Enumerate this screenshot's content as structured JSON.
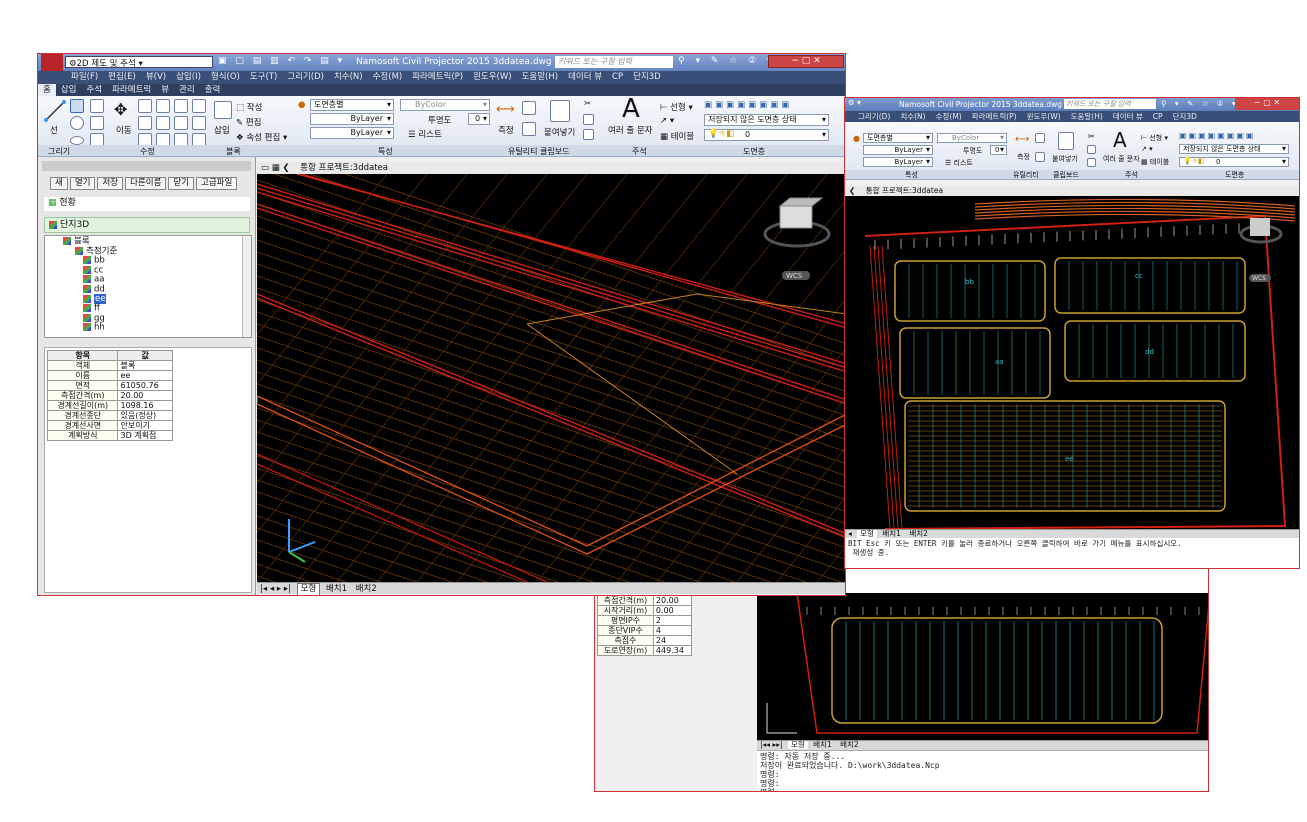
{
  "win3": {
    "props": [
      [
        "측점간격(m)",
        "20.00"
      ],
      [
        "시작거리(m)",
        "0.00"
      ],
      [
        "평면IP수",
        "2"
      ],
      [
        "종단VIP수",
        "4"
      ],
      [
        "측점수",
        "24"
      ],
      [
        "도로연장(m)",
        "449.34"
      ]
    ],
    "tabs": [
      "모형",
      "배치1",
      "배치2"
    ],
    "command_lines": "명령: 자동 저장 중...\n저장이 완료되었습니다. D:\\work\\3ddatea.Ncp\n명령:\n명령:\n명령:"
  },
  "win1": {
    "workspace": "2D 제도 및 주석",
    "title": "Namosoft Civil Projector 2015    3ddatea.dwg",
    "search_placeholder": "키워드 또는 구절 입력",
    "menu": [
      "파일(F)",
      "편집(E)",
      "뷰(V)",
      "삽입(I)",
      "형식(O)",
      "도구(T)",
      "그리기(D)",
      "치수(N)",
      "수정(M)",
      "파라메트릭(P)",
      "윈도우(W)",
      "도움말(H)",
      "데이터 뷰",
      "CP",
      "단지3D"
    ],
    "tabs": [
      "홈",
      "삽입",
      "주석",
      "파라메트릭",
      "뷰",
      "관리",
      "출력"
    ],
    "ribbon": {
      "draw_line": "선",
      "move": "이동",
      "insert": "삽입",
      "block_create": "작성",
      "block_edit": "편집",
      "attr_edit": "속성 편집",
      "layer": "도면층별",
      "bylayer1": "ByLayer",
      "bylayer2": "ByLayer",
      "bycolor": "ByColor",
      "transparency": "투명도",
      "transparency_value": "0",
      "list": "리스트",
      "measure": "측정",
      "paste": "붙여넣기",
      "multiline_text": "여러 줄 문자",
      "linear": "선형",
      "table": "테이블",
      "layer_state": "저장되지 않은 도면층 상태",
      "layer_value": "0",
      "groups": [
        "그리기",
        "수정",
        "블록",
        "특성",
        "유틸리티",
        "클립보드",
        "주석",
        "도면층"
      ]
    },
    "panel": {
      "buttons": [
        "새",
        "열기",
        "저장",
        "다른이름",
        "닫기",
        "고급파일"
      ],
      "status": "현황",
      "root": "단지3D",
      "tree": [
        "블록",
        "측점기준",
        "bb",
        "cc",
        "aa",
        "dd",
        "ee",
        "ff",
        "gg",
        "hh"
      ],
      "table_headers": [
        "항목",
        "값"
      ],
      "rows": [
        [
          "객체",
          "블록"
        ],
        [
          "이름",
          "ee"
        ],
        [
          "면적",
          "61050.76"
        ],
        [
          "측점간격(m)",
          "20.00"
        ],
        [
          "경계선길이(m)",
          "1098.16"
        ],
        [
          "경계선종단",
          "있음(정상)"
        ],
        [
          "경계선사면",
          "안보이기"
        ],
        [
          "계획방식",
          "3D 계획점"
        ]
      ]
    },
    "viewport_label": "통합 프로젝트:3ddatea",
    "tabs_bottom": [
      "모형",
      "배치1",
      "배치2"
    ],
    "wcs": "WCS"
  },
  "win2": {
    "title": "Namosoft Civil Projector 2015    3ddatea.dwg",
    "search_placeholder": "키워드 또는 구절 입력",
    "menu": [
      "그리기(D)",
      "치수(N)",
      "수정(M)",
      "파라메트릭(P)",
      "윈도우(W)",
      "도움말(H)",
      "데이터 뷰",
      "CP",
      "단지3D"
    ],
    "ribbon": {
      "layer": "도면층별",
      "bycolor": "ByColor",
      "bylayer1": "ByLayer",
      "bylayer2": "ByLayer",
      "transparency": "투명도",
      "transparency_value": "0",
      "list": "리스트",
      "measure": "측정",
      "paste": "붙여넣기",
      "multiline_text": "여러 줄 문자",
      "linear": "선형",
      "table": "테이블",
      "layer_state": "저장되지 않은 도면층 상태",
      "layer_value": "0",
      "groups": [
        "특성",
        "유틸리티",
        "클립보드",
        "주석",
        "도면층"
      ]
    },
    "viewport_label": "통합 프로젝트:3ddatea",
    "plan_labels": [
      "bb",
      "cc",
      "aa",
      "dd",
      "ee"
    ],
    "tabs_bottom": [
      "모형",
      "배치1",
      "배치2"
    ],
    "command_lines": "BIT Esc 키 또는 ENTER 키를 눌러 종료하거나 오른쪽 클릭하여 바로 가기 메뉴를 표시하십시오.\n 재생성 중.",
    "wcs": "WCS"
  }
}
